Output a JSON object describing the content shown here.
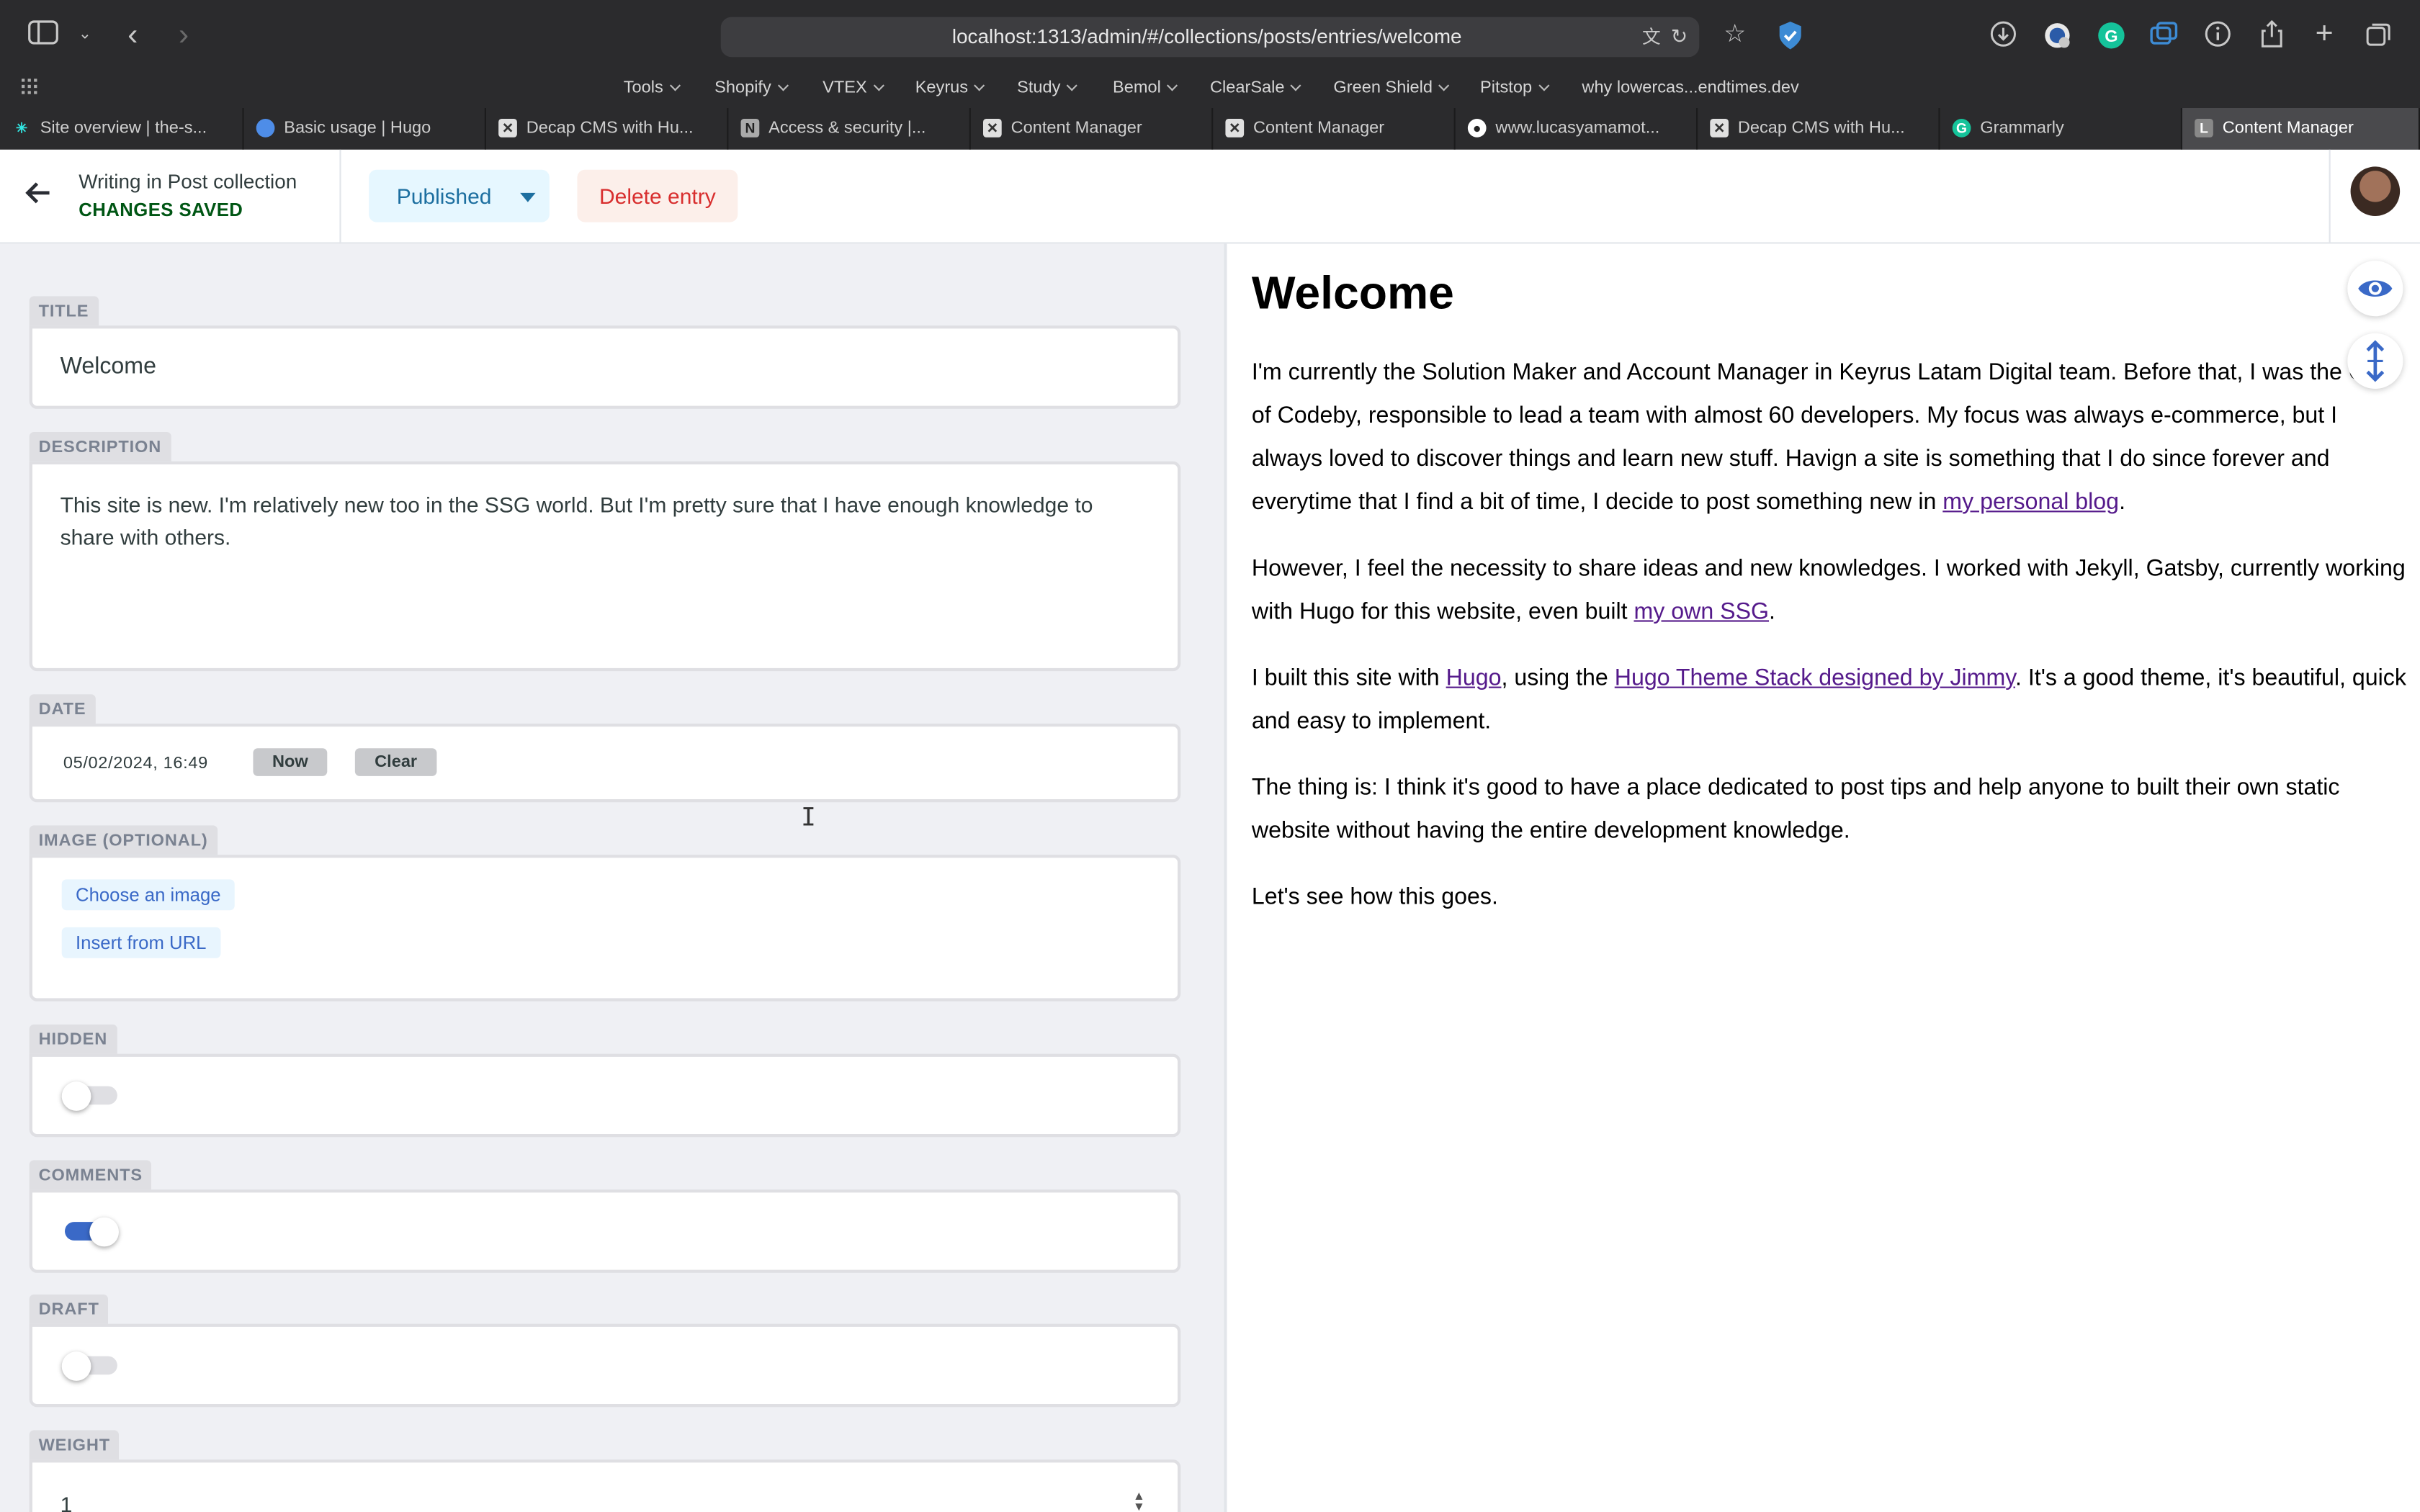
{
  "browser": {
    "url": "localhost:1313/admin/#/collections/posts/entries/welcome",
    "bookmarks": [
      {
        "label": "Tools"
      },
      {
        "label": "Shopify"
      },
      {
        "label": "VTEX"
      },
      {
        "label": "Keyrus"
      },
      {
        "label": "Study"
      },
      {
        "label": "Bemol"
      },
      {
        "label": "ClearSale"
      },
      {
        "label": "Green Shield"
      },
      {
        "label": "Pitstop"
      },
      {
        "label": "why lowercas...endtimes.dev"
      }
    ],
    "tabs": [
      {
        "label": "Site overview | the-s...",
        "icon": "netlify-icon",
        "color": "#32e6e2"
      },
      {
        "label": "Basic usage | Hugo",
        "icon": "hugo-icon",
        "color": "#4e8de8"
      },
      {
        "label": "Decap CMS with Hu...",
        "icon": "x-icon",
        "color": "#e0e0e0"
      },
      {
        "label": "Access & security |...",
        "icon": "notion-icon",
        "color": "#aaaaaa"
      },
      {
        "label": "Content Manager",
        "icon": "x-icon",
        "color": "#e0e0e0"
      },
      {
        "label": "Content Manager",
        "icon": "x-icon",
        "color": "#e0e0e0"
      },
      {
        "label": "www.lucasyamamot...",
        "icon": "github-icon",
        "color": "#ffffff"
      },
      {
        "label": "Decap CMS with Hu...",
        "icon": "x-icon",
        "color": "#e0e0e0"
      },
      {
        "label": "Grammarly",
        "icon": "grammarly-icon",
        "color": "#15c39a"
      },
      {
        "label": "Content Manager",
        "icon": "l-icon",
        "color": "#888888",
        "active": true
      }
    ]
  },
  "header": {
    "entry_title": "Writing in Post collection",
    "entry_status": "CHANGES SAVED",
    "publish_label": "Published",
    "delete_label": "Delete entry"
  },
  "fields": {
    "title": {
      "label": "TITLE",
      "value": "Welcome"
    },
    "description": {
      "label": "DESCRIPTION",
      "value": "This site is new. I'm relatively new too in the SSG world. But I'm pretty sure that I have enough knowledge to share with others."
    },
    "date": {
      "label": "DATE",
      "value": "05/02/2024, 16:49",
      "now_label": "Now",
      "clear_label": "Clear"
    },
    "image": {
      "label": "IMAGE (OPTIONAL)",
      "choose_label": "Choose an image",
      "url_label": "Insert from URL"
    },
    "hidden": {
      "label": "HIDDEN",
      "on": false
    },
    "comments": {
      "label": "COMMENTS",
      "on": true
    },
    "draft": {
      "label": "DRAFT",
      "on": false
    },
    "weight": {
      "label": "WEIGHT",
      "value": "1"
    }
  },
  "preview": {
    "title": "Welcome",
    "p1": {
      "text": "I'm currently the Solution Maker and Account Manager in Keyrus Latam Digital team. Before that, I was the CTO of Codeby, responsible to lead a team with almost 60 developers. My focus was always e-commerce, but I always loved to discover things and learn new stuff. Havign a site is something that I do since forever and everytime that I find a bit of time, I decide to post something new in ",
      "link": "my personal blog",
      "tail": "."
    },
    "p2": {
      "text": "However, I feel the necessity to share ideas and new knowledges. I worked with Jekyll, Gatsby, currently working with Hugo for this website, even built ",
      "link": "my own SSG",
      "tail": "."
    },
    "p3": {
      "text": "I built this site with ",
      "link1": "Hugo",
      "mid": ", using the ",
      "link2": "Hugo Theme Stack designed by Jimmy",
      "tail": ". It's a good theme, it's beautiful, quick and easy to implement."
    },
    "p4": "The thing is: I think it's good to have a place dedicated to post tips and help anyone to built their own static website without having the entire development knowledge.",
    "p5": "Let's see how this goes."
  },
  "colors": {
    "accent": "#3a69c7",
    "status_saved": "#005614",
    "delete": "#d82e2e",
    "link_visited": "#551a8b"
  }
}
